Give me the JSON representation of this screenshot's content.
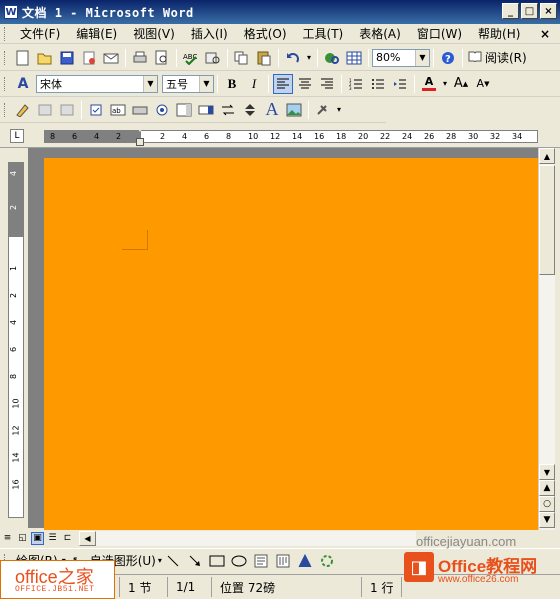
{
  "window": {
    "title": "文档 1 - Microsoft Word",
    "app_icon": "W"
  },
  "menubar": {
    "items": [
      "文件(F)",
      "编辑(E)",
      "视图(V)",
      "插入(I)",
      "格式(O)",
      "工具(T)",
      "表格(A)",
      "窗口(W)",
      "帮助(H)"
    ],
    "close_x": "×"
  },
  "standard_toolbar": {
    "zoom": "80%",
    "read_label": "阅读(R)"
  },
  "formatting_toolbar": {
    "style_icon_label": "A",
    "font": "宋体",
    "size": "五号",
    "bold": "B",
    "italic": "I",
    "font_color_label": "A"
  },
  "hruler": {
    "left_ticks": [
      "8",
      "6",
      "4",
      "2"
    ],
    "right_ticks": [
      "2",
      "4",
      "6",
      "8",
      "10",
      "12",
      "14",
      "16",
      "18",
      "20",
      "22",
      "24",
      "26",
      "28",
      "30",
      "32",
      "34"
    ]
  },
  "vruler": {
    "ticks": [
      "4",
      "2",
      "1",
      "2",
      "4",
      "6",
      "8",
      "10",
      "12",
      "14",
      "16"
    ]
  },
  "page": {
    "background_color": "#ff9900"
  },
  "drawbar": {
    "draw_label": "绘图(R)",
    "autoshape_label": "自选图形(U)"
  },
  "statusbar": {
    "section": "1 节",
    "pages": "1/1",
    "position": "位置 72磅",
    "line": "1 行"
  },
  "watermarks": {
    "left_brand": "office之家",
    "left_url": "OFFICE.JB51.NET",
    "right_url": "officejiayuan.com",
    "right_brand": "Office教程网",
    "right_sub": "www.office26.com"
  }
}
